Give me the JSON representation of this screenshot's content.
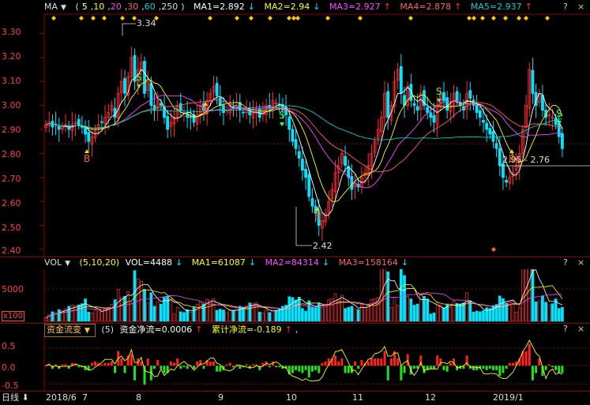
{
  "main_header": {
    "indicator": "MA",
    "params_open": "(",
    "p1": "5",
    "p2": "10",
    "p3": "20",
    "p4": "30",
    "p5": "60",
    "p6": "250",
    "params_close": ")",
    "ma1": "MA1=2.892",
    "ma1_arrow": "↓",
    "ma2": "MA2=2.94",
    "ma2_arrow": "↓",
    "ma3": "MA3=2.927",
    "ma3_arrow": "↑",
    "ma4": "MA4=2.878",
    "ma4_arrow": "↑",
    "ma5": "MA5=2.937",
    "ma5_arrow": "↑"
  },
  "vol_header": {
    "indicator": "VOL",
    "params": "(5,10,20)",
    "vol": "VOL=4488",
    "vol_arrow": "↓",
    "ma1": "MA1=61087",
    "ma1_arrow": "↓",
    "ma2": "MA2=84314",
    "ma2_arrow": "↓",
    "ma3": "MA3=158164",
    "ma3_arrow": "↓"
  },
  "flow_header": {
    "tab": "资金流变",
    "params": "(5)",
    "net": "资金净流=0.0006",
    "net_arrow": "↑",
    "cum": "累计净流=-0.189",
    "cum_arrow": "↑",
    "tail": ","
  },
  "panel_controls": {
    "help": "?",
    "close": "×"
  },
  "price_axis": [
    "3.30",
    "3.20",
    "3.10",
    "3.00",
    "2.90",
    "2.80",
    "2.70",
    "2.60",
    "2.50",
    "2.40"
  ],
  "vol_axis": [
    "5000",
    "x100"
  ],
  "flow_axis": [
    "0.5",
    "0.0",
    "-0.5"
  ],
  "annotations": {
    "high": "3.34",
    "low": "2.42",
    "range": "2.95 - 2.76",
    "buy": "B",
    "sell": "S"
  },
  "date_bar": {
    "period": "日线",
    "period_arrow": "⬇",
    "dates": [
      "2018/6",
      "7",
      "8",
      "9",
      "10",
      "11",
      "12",
      "2019/1"
    ]
  },
  "colors": {
    "up": "#ff3030",
    "down": "#00e5ff",
    "ma1": "#ffffff",
    "ma2": "#ffff00",
    "ma3": "#ff44ff",
    "ma4": "#ff6060",
    "ma5": "#00d0d0",
    "grid": "#8a0000"
  },
  "chart_data": {
    "type": "candlestick",
    "y_range": [
      2.38,
      3.38
    ],
    "dates": [
      "2018/6",
      "7",
      "8",
      "9",
      "10",
      "11",
      "12",
      "2019/1"
    ],
    "close": [
      2.92,
      2.93,
      2.91,
      2.92,
      2.9,
      2.91,
      2.92,
      2.9,
      2.92,
      2.93,
      2.92,
      2.91,
      2.88,
      2.85,
      2.87,
      2.9,
      2.92,
      2.93,
      2.95,
      2.97,
      3.0,
      2.95,
      3.05,
      3.1,
      3.05,
      3.12,
      3.2,
      3.1,
      3.15,
      3.18,
      3.05,
      3.1,
      3.0,
      2.98,
      3.02,
      3.0,
      2.95,
      2.9,
      2.93,
      2.95,
      3.0,
      2.98,
      2.97,
      2.95,
      2.95,
      2.93,
      2.96,
      3.0,
      2.98,
      3.02,
      3.05,
      3.08,
      3.04,
      3.0,
      2.97,
      2.98,
      3.0,
      2.99,
      3.0,
      2.98,
      2.97,
      2.98,
      2.96,
      2.97,
      2.98,
      2.95,
      2.97,
      3.0,
      2.99,
      3.02,
      3.01,
      3.0,
      2.98,
      2.96,
      2.9,
      2.85,
      2.82,
      2.78,
      2.73,
      2.7,
      2.62,
      2.58,
      2.55,
      2.5,
      2.52,
      2.55,
      2.6,
      2.65,
      2.72,
      2.75,
      2.8,
      2.75,
      2.7,
      2.65,
      2.68,
      2.66,
      2.7,
      2.72,
      2.75,
      2.8,
      2.85,
      2.9,
      2.95,
      3.05,
      2.95,
      3.0,
      3.1,
      3.15,
      3.05,
      3.0,
      3.08,
      3.02,
      3.0,
      2.98,
      3.05,
      3.0,
      2.97,
      2.95,
      2.93,
      3.0,
      3.05,
      3.02,
      2.98,
      3.0,
      3.05,
      3.02,
      3.0,
      2.98,
      3.05,
      3.03,
      3.0,
      2.97,
      2.95,
      2.93,
      2.9,
      2.88,
      2.85,
      2.82,
      2.75,
      2.7,
      2.68,
      2.7,
      2.72,
      2.75,
      2.8,
      2.9,
      3.0,
      3.15,
      3.05,
      3.0,
      3.05,
      2.98,
      2.95,
      2.96,
      2.95,
      2.92,
      2.87,
      2.82
    ],
    "volume_max": 8000,
    "flow_range": [
      -0.6,
      0.7
    ]
  }
}
